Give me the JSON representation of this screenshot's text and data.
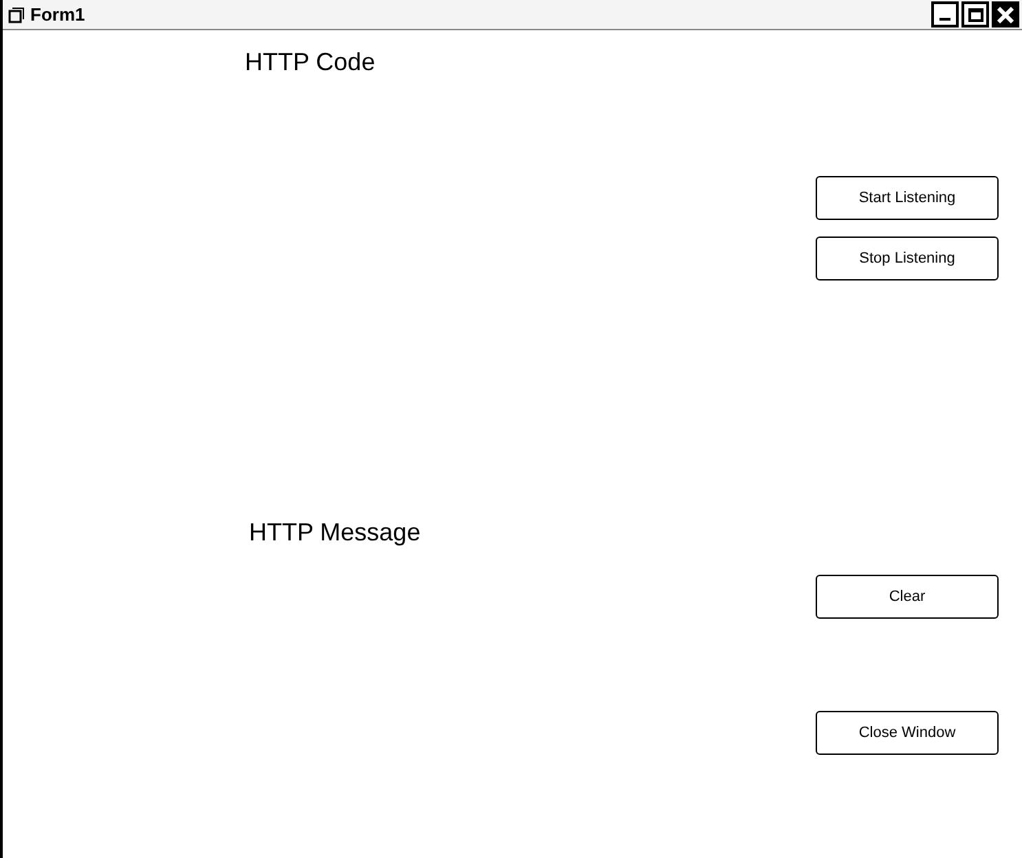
{
  "window": {
    "title": "Form1"
  },
  "labels": [
    "HTTP Code",
    "HTTP Message"
  ],
  "buttons": [
    "Start Listening",
    "Stop Listening",
    "Clear",
    "Close Window"
  ]
}
